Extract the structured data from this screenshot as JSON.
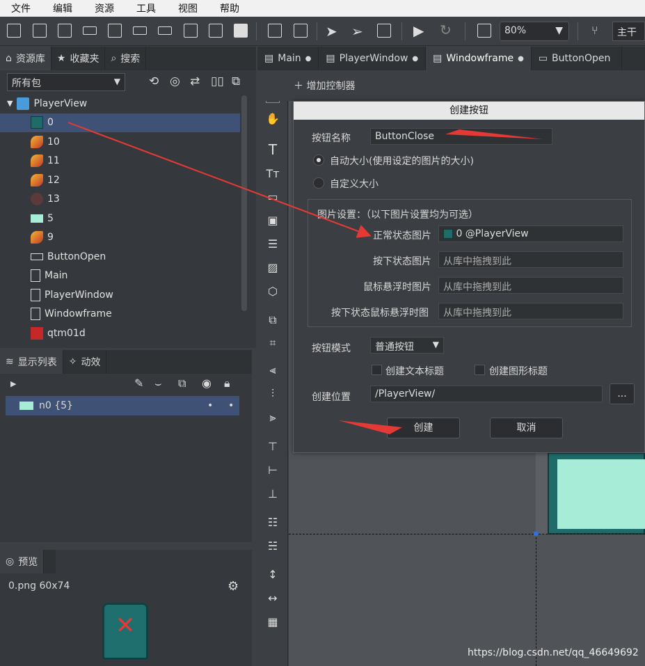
{
  "menu": [
    "文件",
    "编辑",
    "资源",
    "工具",
    "视图",
    "帮助"
  ],
  "toolbar": {
    "zoom": "80%",
    "branch": "主干"
  },
  "left_tabs": [
    {
      "label": "资源库",
      "icon": "home-icon"
    },
    {
      "label": "收藏夹",
      "icon": "star-icon"
    },
    {
      "label": "搜索",
      "icon": "search-icon"
    }
  ],
  "package_select": "所有包",
  "tree": {
    "root": "PlayerView",
    "items": [
      {
        "label": "0",
        "icon": "close-button-thumb-icon",
        "selected": true
      },
      {
        "label": "10",
        "icon": "flame-image-icon"
      },
      {
        "label": "11",
        "icon": "flame-image-icon"
      },
      {
        "label": "12",
        "icon": "flame-image-icon"
      },
      {
        "label": "13",
        "icon": "dark-image-icon"
      },
      {
        "label": "5",
        "icon": "teal-image-icon"
      },
      {
        "label": "9",
        "icon": "flame-image-icon"
      },
      {
        "label": "ButtonOpen",
        "icon": "button-component-icon"
      },
      {
        "label": "Main",
        "icon": "document-icon"
      },
      {
        "label": "PlayerWindow",
        "icon": "document-icon"
      },
      {
        "label": "Windowframe",
        "icon": "document-icon"
      },
      {
        "label": "qtm01d",
        "icon": "flash-icon"
      }
    ]
  },
  "display_tabs": [
    {
      "label": "显示列表",
      "icon": "layers-icon"
    },
    {
      "label": "动效",
      "icon": "sparkle-icon"
    }
  ],
  "display_list": {
    "item": "n0 {5}"
  },
  "preview": {
    "title": "预览",
    "info": "0.png   60x74"
  },
  "doc_tabs": [
    {
      "label": "Main",
      "active": false
    },
    {
      "label": "PlayerWindow",
      "active": false
    },
    {
      "label": "Windowframe",
      "active": true
    },
    {
      "label": "ButtonOpen",
      "active": false
    }
  ],
  "add_controller": "增加控制器",
  "dialog": {
    "title": "创建按钮",
    "name_label": "按钮名称",
    "name_value": "ButtonClose",
    "radio_auto": "自动大小(使用设定的图片的大小)",
    "radio_custom": "自定义大小",
    "group_title": "图片设置：（以下图片设置均为可选）",
    "normal_label": "正常状态图片",
    "normal_value": "0 @PlayerView",
    "down_label": "按下状态图片",
    "hover_label": "鼠标悬浮时图片",
    "down_hover_label": "按下状态鼠标悬浮时图",
    "drag_placeholder": "从库中拖拽到此",
    "mode_label": "按钮模式",
    "mode_value": "普通按钮",
    "chk_text": "创建文本标题",
    "chk_graphic": "创建图形标题",
    "location_label": "创建位置",
    "location_value": "/PlayerView/",
    "browse": "...",
    "create": "创建",
    "cancel": "取消"
  },
  "watermark": "https://blog.csdn.net/qq_46649692",
  "colors": {
    "accent": "#3f5275",
    "arrow": "#e53935",
    "teal": "#a6ecd6"
  }
}
